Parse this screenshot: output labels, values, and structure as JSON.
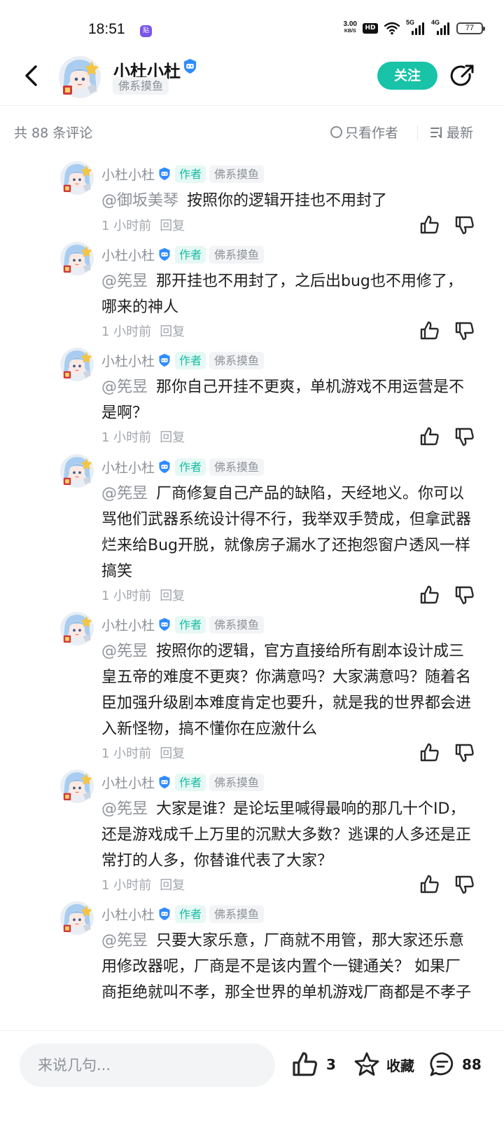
{
  "status_bar": {
    "time": "18:51",
    "app_icon": "贴",
    "net_speed_value": "3.00",
    "net_speed_unit": "KB/S",
    "hd": "HD",
    "sig1": "5G",
    "sig2": "4G",
    "battery": "77"
  },
  "header": {
    "user_name": "小杜小杜",
    "user_tag": "佛系摸鱼",
    "follow_label": "关注"
  },
  "meta": {
    "comment_count": "共 88 条评论",
    "only_author": "只看作者",
    "sort": "最新"
  },
  "comments": [
    {
      "name": "小杜小杜",
      "author_badge": "作者",
      "tag": "佛系摸鱼",
      "mention": "@御坂美琴",
      "text": "按照你的逻辑开挂也不用封了",
      "time": "1 小时前",
      "reply": "回复"
    },
    {
      "name": "小杜小杜",
      "author_badge": "作者",
      "tag": "佛系摸鱼",
      "mention": "@筅昱",
      "text": "那开挂也不用封了，之后出bug也不用修了，哪来的神人",
      "time": "1 小时前",
      "reply": "回复"
    },
    {
      "name": "小杜小杜",
      "author_badge": "作者",
      "tag": "佛系摸鱼",
      "mention": "@筅昱",
      "text": "那你自己开挂不更爽，单机游戏不用运营是不是啊？",
      "time": "1 小时前",
      "reply": "回复"
    },
    {
      "name": "小杜小杜",
      "author_badge": "作者",
      "tag": "佛系摸鱼",
      "mention": "@筅昱",
      "text": "厂商修复自己产品的缺陷，天经地义。你可以骂他们武器系统设计得不行，我举双手赞成，但拿武器烂来给Bug开脱，就像房子漏水了还抱怨窗户透风一样搞笑",
      "time": "1 小时前",
      "reply": "回复"
    },
    {
      "name": "小杜小杜",
      "author_badge": "作者",
      "tag": "佛系摸鱼",
      "mention": "@筅昱",
      "text": "按照你的逻辑，官方直接给所有剧本设计成三皇五帝的难度不更爽？你满意吗？大家满意吗？随着名臣加强升级剧本难度肯定也要升，就是我的世界都会进入新怪物，搞不懂你在应激什么",
      "time": "1 小时前",
      "reply": "回复"
    },
    {
      "name": "小杜小杜",
      "author_badge": "作者",
      "tag": "佛系摸鱼",
      "mention": "@筅昱",
      "text": "大家是谁？是论坛里喊得最响的那几十个ID，还是游戏成千上万里的沉默大多数？逃课的人多还是正常打的人多，你替谁代表了大家？",
      "time": "1 小时前",
      "reply": "回复"
    },
    {
      "name": "小杜小杜",
      "author_badge": "作者",
      "tag": "佛系摸鱼",
      "mention": "@筅昱",
      "text": "只要大家乐意，厂商就不用管，那大家还乐意用修改器呢，厂商是不是该内置个一键通关？ 如果厂商拒绝就叫不孝，那全世界的单机游戏厂商都是不孝子",
      "time": "",
      "reply": ""
    }
  ],
  "bottom_bar": {
    "input_placeholder": "来说几句...",
    "like_count": "3",
    "fav_label": "收藏",
    "comment_count": "88"
  },
  "colors": {
    "accent": "#18c3a8",
    "verified": "#2f8cff",
    "muted_text": "#8e9298"
  }
}
